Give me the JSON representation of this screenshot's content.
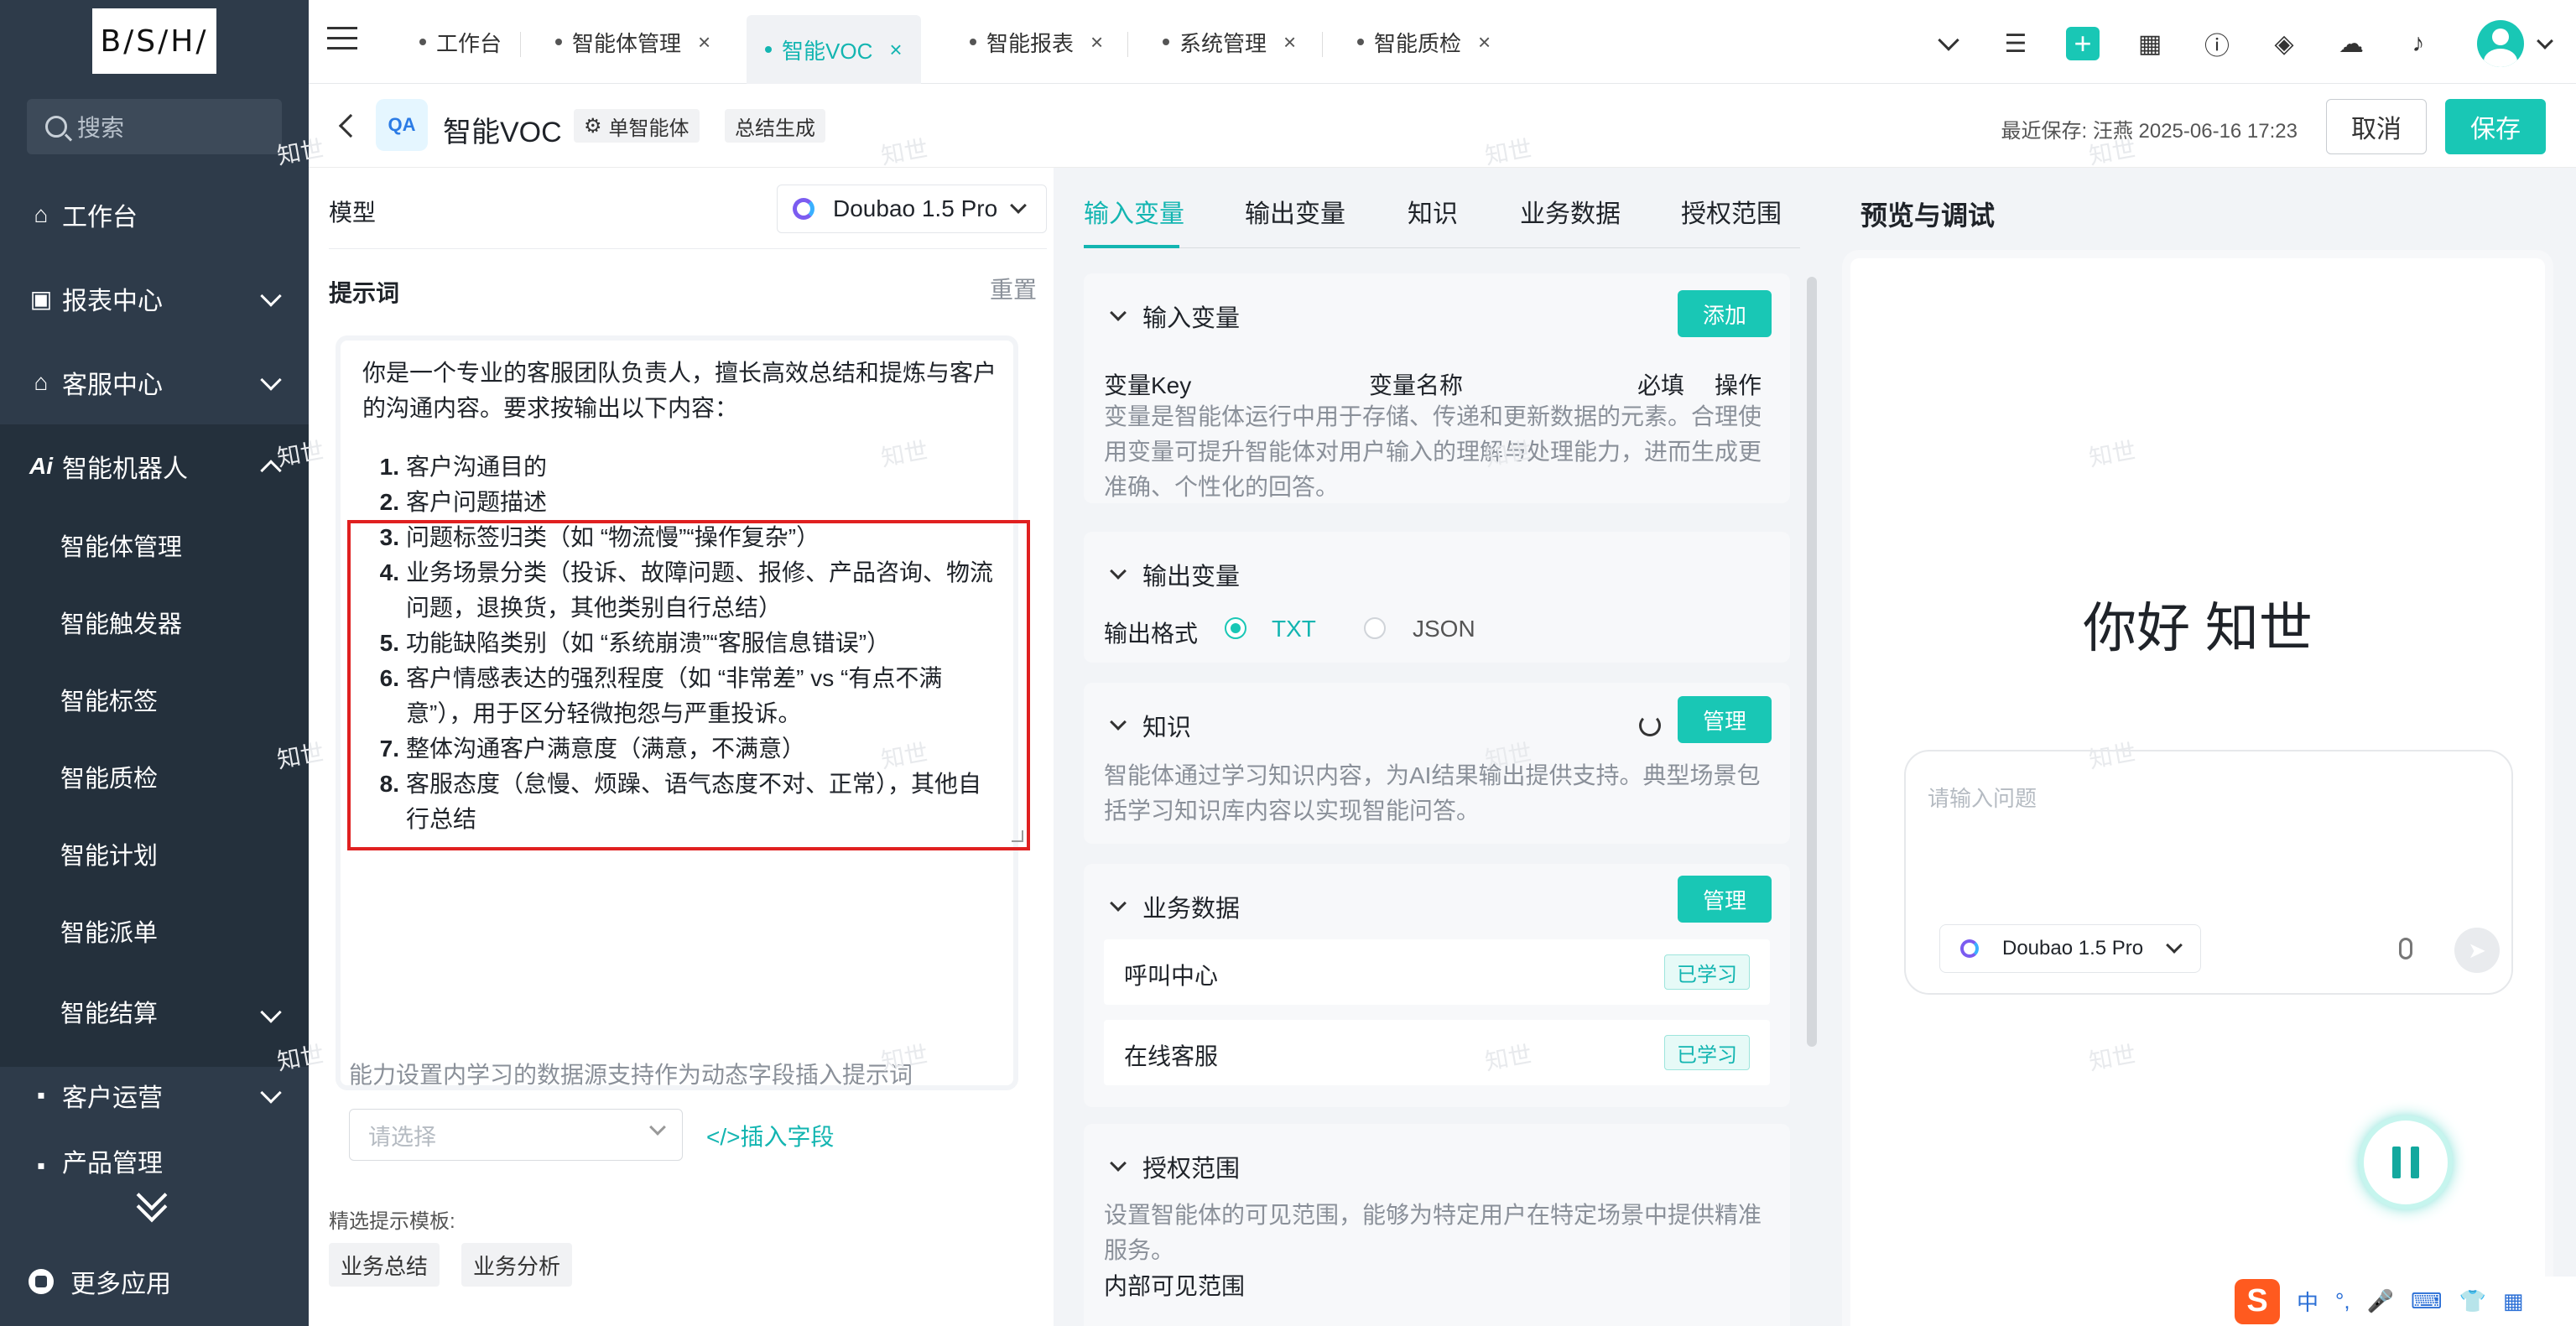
{
  "sidebar": {
    "logo": "B/S/H/",
    "search_placeholder": "搜索",
    "items": [
      {
        "label": "工作台",
        "icon": "home-icon"
      },
      {
        "label": "报表中心",
        "icon": "chart-icon"
      },
      {
        "label": "客服中心",
        "icon": "headset-icon"
      },
      {
        "label": "智能机器人",
        "icon": "ai-icon"
      }
    ],
    "sub_items": [
      "智能体管理",
      "智能触发器",
      "智能标签",
      "智能质检",
      "智能计划",
      "智能派单",
      "智能结算"
    ],
    "items_after": [
      {
        "label": "客户运营",
        "icon": "user-icon"
      },
      {
        "label": "产品管理",
        "icon": "box-icon"
      }
    ],
    "more_apps": "更多应用"
  },
  "tabs": [
    {
      "label": "工作台",
      "closable": false
    },
    {
      "label": "智能体管理",
      "closable": true
    },
    {
      "label": "智能VOC",
      "closable": true,
      "active": true
    },
    {
      "label": "智能报表",
      "closable": true
    },
    {
      "label": "系统管理",
      "closable": true
    },
    {
      "label": "智能质检",
      "closable": true
    }
  ],
  "header": {
    "title": "智能VOC",
    "chip_single_agent": "单智能体",
    "chip_summary": "总结生成",
    "save_info": "最近保存: 汪燕 2025-06-16 17:23",
    "cancel": "取消",
    "save": "保存"
  },
  "left": {
    "model_label": "模型",
    "model_value": "Doubao 1.5 Pro",
    "prompt_label": "提示词",
    "reset": "重置",
    "prompt_intro": "你是一个专业的客服团队负责人，擅长高效总结和提炼与客户的沟通内容。要求按输出以下内容：",
    "prompt_items": [
      "客户沟通目的",
      "客户问题描述",
      "问题标签归类（如 “物流慢”“操作复杂”）",
      "业务场景分类（投诉、故障问题、报修、产品咨询、物流问题，退换货，其他类别自行总结）",
      "功能缺陷类别（如 “系统崩溃”“客服信息错误”）",
      "客户情感表达的强烈程度（如 “非常差” vs “有点不满意”），用于区分轻微抱怨与严重投诉。",
      "整体沟通客户满意度（满意，不满意）",
      "客服态度（怠慢、烦躁、语气态度不对、正常），其他自行总结"
    ],
    "hint": "能力设置内学习的数据源支持作为动态字段插入提示词",
    "select_placeholder": "请选择",
    "insert_link": "</>插入字段",
    "template_label": "精选提示模板:",
    "templates": [
      "业务总结",
      "业务分析"
    ]
  },
  "middle": {
    "tabs": [
      "输入变量",
      "输出变量",
      "知识",
      "业务数据",
      "授权范围"
    ],
    "input_vars": {
      "title": "输入变量",
      "add": "添加",
      "columns": [
        "变量Key",
        "变量名称",
        "必填",
        "操作"
      ],
      "desc": "变量是智能体运行中用于存储、传递和更新数据的元素。合理使用变量可提升智能体对用户输入的理解与处理能力，进而生成更准确、个性化的回答。"
    },
    "output_vars": {
      "title": "输出变量",
      "format_label": "输出格式",
      "options": [
        "TXT",
        "JSON"
      ],
      "selected": "TXT"
    },
    "knowledge": {
      "title": "知识",
      "manage": "管理",
      "desc": "智能体通过学习知识内容，为AI结果输出提供支持。典型场景包括学习知识库内容以实现智能问答。"
    },
    "business": {
      "title": "业务数据",
      "manage": "管理",
      "rows": [
        {
          "name": "呼叫中心",
          "status": "已学习"
        },
        {
          "name": "在线客服",
          "status": "已学习"
        }
      ]
    },
    "auth": {
      "title": "授权范围",
      "desc": "设置智能体的可见范围，能够为特定用户在特定场景中提供精准服务。",
      "sub": "内部可见范围"
    }
  },
  "right": {
    "title": "预览与调试",
    "greeting": "你好 知世",
    "input_placeholder": "请输入问题",
    "model_value": "Doubao 1.5 Pro"
  },
  "watermark": "知世",
  "ime": {
    "logo": "S",
    "items": [
      "中",
      "°,",
      "🎤",
      "⌨",
      "👕",
      "▦"
    ]
  }
}
